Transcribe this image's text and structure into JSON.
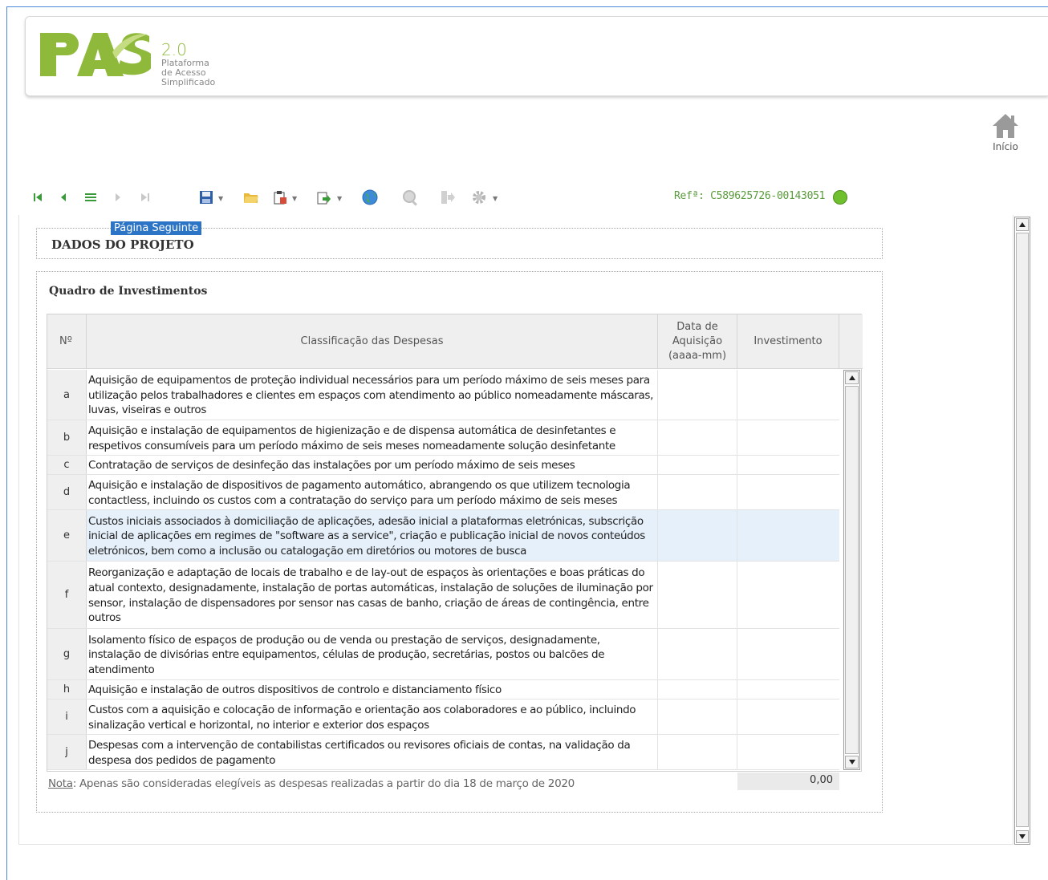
{
  "logo": {
    "version": "2.0",
    "line1": "Plataforma",
    "line2": "de Acesso",
    "line3": "Simplificado"
  },
  "home": {
    "label": "Início",
    "icon": "home-icon"
  },
  "toolbar": {
    "icons": [
      "first-page-icon",
      "prev-page-icon",
      "list-icon",
      "next-page-icon",
      "last-page-icon",
      "save-icon",
      "open-folder-icon",
      "clipboard-icon",
      "export-icon",
      "globe-icon",
      "search-icon",
      "exit-icon",
      "gear-icon"
    ],
    "tooltip": "Página Seguinte",
    "reference": "Refª: C589625726-00143051",
    "status_color": "#6fbf2f"
  },
  "section_project": {
    "title": "DADOS DO PROJETO"
  },
  "investments": {
    "title": "Quadro de Investimentos",
    "columns": {
      "no": "Nº",
      "classification": "Classificação das Despesas",
      "date": "Data de Aquisição (aaaa-mm)",
      "investment": "Investimento"
    },
    "rows": [
      {
        "no": "a",
        "text": "Aquisição de equipamentos de proteção individual necessários para um período máximo de seis meses para utilização pelos trabalhadores e clientes em espaços com atendimento ao público nomeadamente máscaras, luvas, viseiras e outros",
        "date": "",
        "investment": ""
      },
      {
        "no": "b",
        "text": "Aquisição e instalação de equipamentos de higienização e de dispensa automática de desinfetantes e respetivos consumíveis para um período máximo de seis meses nomeadamente solução desinfetante",
        "date": "",
        "investment": ""
      },
      {
        "no": "c",
        "text": "Contratação de serviços de desinfeção das instalações por um período máximo de seis meses",
        "date": "",
        "investment": ""
      },
      {
        "no": "d",
        "text": "Aquisição e instalação de dispositivos de pagamento automático, abrangendo os que utilizem tecnologia contactless, incluindo os custos com a contratação do serviço para um período máximo de seis meses",
        "date": "",
        "investment": ""
      },
      {
        "no": "e",
        "text": "Custos iniciais associados à domiciliação de aplicações, adesão inicial a plataformas eletrónicas, subscrição inicial de aplicações em regimes de \"software as a service\", criação e publicação inicial de novos conteúdos eletrónicos, bem como a inclusão ou catalogação em diretórios ou motores de busca",
        "date": "",
        "investment": ""
      },
      {
        "no": "f",
        "text": "Reorganização e adaptação de locais de trabalho e de lay-out de espaços às orientações e boas práticas do atual contexto, designadamente, instalação de portas automáticas, instalação de soluções de iluminação por sensor, instalação de dispensadores por sensor nas casas de banho, criação de áreas de contingência, entre outros",
        "date": "",
        "investment": ""
      },
      {
        "no": "g",
        "text": "Isolamento físico de espaços de produção ou de venda ou prestação de serviços, designadamente, instalação de divisórias entre equipamentos, células de produção, secretárias, postos ou balcões de atendimento",
        "date": "",
        "investment": ""
      },
      {
        "no": "h",
        "text": "Aquisição e instalação de outros dispositivos de controlo e distanciamento físico",
        "date": "",
        "investment": ""
      },
      {
        "no": "i",
        "text": "Custos com a aquisição e colocação de informação e orientação aos colaboradores e ao público, incluindo sinalização vertical e horizontal, no interior e exterior dos espaços",
        "date": "",
        "investment": ""
      },
      {
        "no": "j",
        "text": "Despesas com a intervenção de contabilistas certificados ou revisores oficiais de contas, na validação da despesa dos pedidos de pagamento",
        "date": "",
        "investment": ""
      }
    ],
    "total": "0,00",
    "note_label": "Nota",
    "note_text": ": Apenas são consideradas elegíveis as despesas realizadas a partir do dia 18 de março de 2020"
  }
}
